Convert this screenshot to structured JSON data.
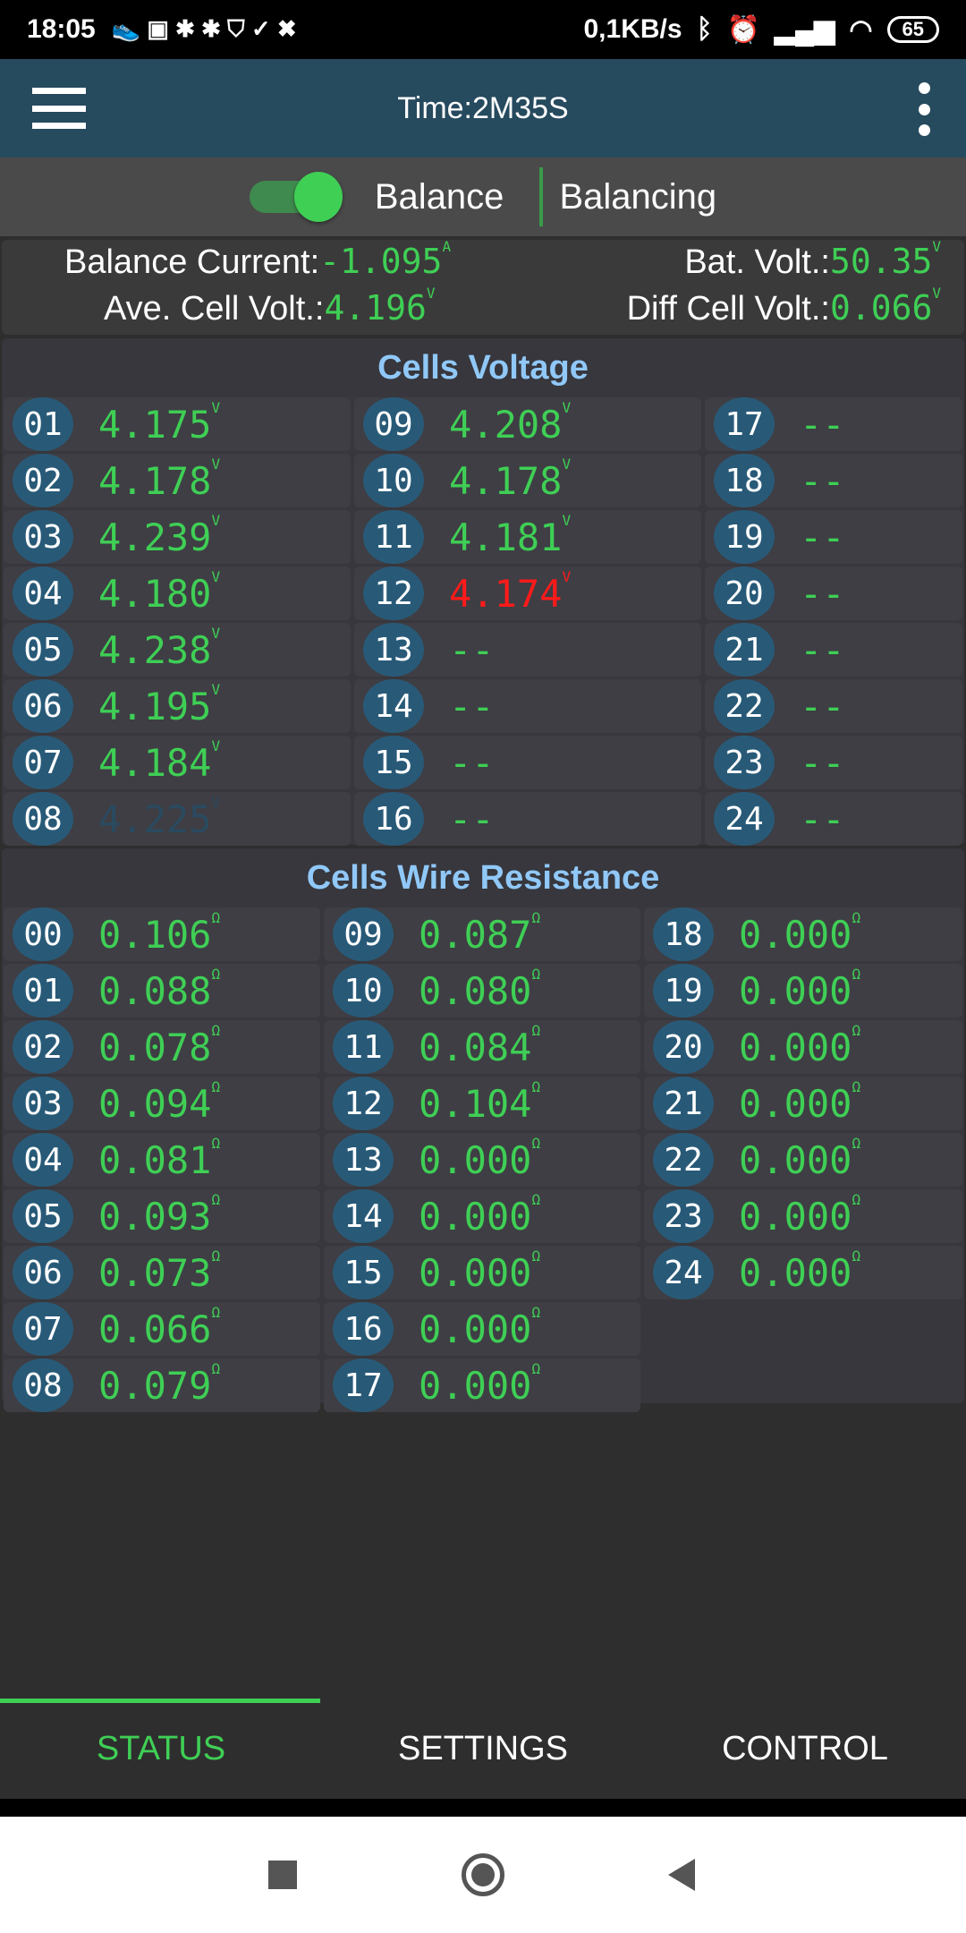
{
  "status_bar": {
    "time": "18:05",
    "net_speed": "0,1KB/s",
    "battery": "65"
  },
  "app_bar": {
    "title": "Time:2M35S"
  },
  "balance": {
    "toggle_on": true,
    "label": "Balance",
    "state": "Balancing"
  },
  "info": {
    "balance_current_label": "Balance Current:",
    "balance_current": "-1.095",
    "balance_current_unit": "A",
    "bat_volt_label": "Bat. Volt.:",
    "bat_volt": "50.35",
    "bat_volt_unit": "V",
    "ave_cell_label": "Ave. Cell Volt.:",
    "ave_cell": "4.196",
    "ave_cell_unit": "V",
    "diff_cell_label": "Diff Cell Volt.:",
    "diff_cell": "0.066",
    "diff_cell_unit": "V"
  },
  "cells_voltage": {
    "title": "Cells Voltage",
    "unit": "V",
    "cells": [
      {
        "id": "01",
        "value": "4.175"
      },
      {
        "id": "02",
        "value": "4.178"
      },
      {
        "id": "03",
        "value": "4.239"
      },
      {
        "id": "04",
        "value": "4.180"
      },
      {
        "id": "05",
        "value": "4.238"
      },
      {
        "id": "06",
        "value": "4.195"
      },
      {
        "id": "07",
        "value": "4.184"
      },
      {
        "id": "08",
        "value": "4.225",
        "state": "dim"
      },
      {
        "id": "09",
        "value": "4.208"
      },
      {
        "id": "10",
        "value": "4.178"
      },
      {
        "id": "11",
        "value": "4.181"
      },
      {
        "id": "12",
        "value": "4.174",
        "state": "low"
      },
      {
        "id": "13",
        "value": "--"
      },
      {
        "id": "14",
        "value": "--"
      },
      {
        "id": "15",
        "value": "--"
      },
      {
        "id": "16",
        "value": "--"
      },
      {
        "id": "17",
        "value": "--"
      },
      {
        "id": "18",
        "value": "--"
      },
      {
        "id": "19",
        "value": "--"
      },
      {
        "id": "20",
        "value": "--"
      },
      {
        "id": "21",
        "value": "--"
      },
      {
        "id": "22",
        "value": "--"
      },
      {
        "id": "23",
        "value": "--"
      },
      {
        "id": "24",
        "value": "--"
      }
    ]
  },
  "wire_resistance": {
    "title": "Cells Wire Resistance",
    "unit": "Ω",
    "cells": [
      {
        "id": "00",
        "value": "0.106"
      },
      {
        "id": "01",
        "value": "0.088"
      },
      {
        "id": "02",
        "value": "0.078"
      },
      {
        "id": "03",
        "value": "0.094"
      },
      {
        "id": "04",
        "value": "0.081"
      },
      {
        "id": "05",
        "value": "0.093"
      },
      {
        "id": "06",
        "value": "0.073"
      },
      {
        "id": "07",
        "value": "0.066"
      },
      {
        "id": "08",
        "value": "0.079"
      },
      {
        "id": "09",
        "value": "0.087"
      },
      {
        "id": "10",
        "value": "0.080"
      },
      {
        "id": "11",
        "value": "0.084"
      },
      {
        "id": "12",
        "value": "0.104"
      },
      {
        "id": "13",
        "value": "0.000"
      },
      {
        "id": "14",
        "value": "0.000"
      },
      {
        "id": "15",
        "value": "0.000"
      },
      {
        "id": "16",
        "value": "0.000"
      },
      {
        "id": "17",
        "value": "0.000"
      },
      {
        "id": "18",
        "value": "0.000"
      },
      {
        "id": "19",
        "value": "0.000"
      },
      {
        "id": "20",
        "value": "0.000"
      },
      {
        "id": "21",
        "value": "0.000"
      },
      {
        "id": "22",
        "value": "0.000"
      },
      {
        "id": "23",
        "value": "0.000"
      },
      {
        "id": "24",
        "value": "0.000"
      }
    ]
  },
  "tabs": [
    {
      "label": "STATUS",
      "active": true
    },
    {
      "label": "SETTINGS"
    },
    {
      "label": "CONTROL"
    }
  ],
  "colors": {
    "accent": "#3fcf55",
    "appbar": "#264a5e",
    "low": "#ff1a1a",
    "title": "#90c8f8"
  }
}
